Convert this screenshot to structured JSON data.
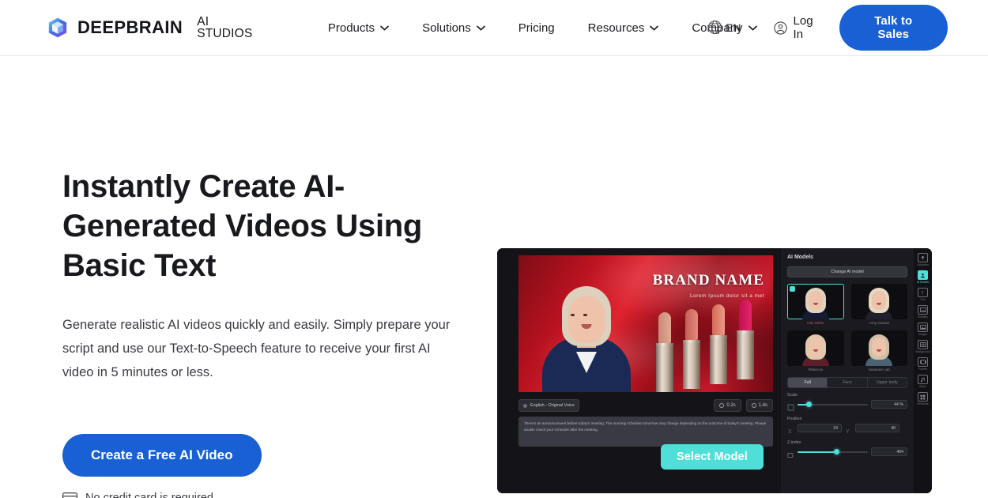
{
  "header": {
    "brand": {
      "name": "DEEPBRAIN",
      "sub": "AI STUDIOS",
      "logo_icon": "cube-logo-icon"
    },
    "nav": [
      {
        "label": "Products",
        "has_caret": true
      },
      {
        "label": "Solutions",
        "has_caret": true
      },
      {
        "label": "Pricing",
        "has_caret": false
      },
      {
        "label": "Resources",
        "has_caret": true
      },
      {
        "label": "Company",
        "has_caret": true
      }
    ],
    "language": {
      "label": "EN",
      "icon": "globe-icon"
    },
    "login": {
      "label": "Log In",
      "icon": "user-circle-icon"
    },
    "cta": {
      "label": "Talk to Sales"
    }
  },
  "hero": {
    "title": "Instantly Create AI-Generated Videos Using Basic Text",
    "description": "Generate realistic AI videos quickly and easily. Simply prepare your script and use our Text-to-Speech feature to receive your first AI video in 5 minutes or less.",
    "cta_label": "Create a Free AI Video",
    "no_card_note": "No credit card is required",
    "no_card_icon": "credit-card-icon"
  },
  "mockup": {
    "stage": {
      "brand_title": "BRAND NAME",
      "brand_subtitle": "Lorem Ipsum dolor sit a met"
    },
    "toolbar": {
      "voice_chip": "English - Original Voice",
      "time_chips": [
        "0.2s",
        "1.4s"
      ]
    },
    "script_placeholder": "There's an announcement before today's meeting. The morning schedule tomorrow may change depending on the outcome of today's meeting. Please double check your schedule after the meeting.",
    "select_model_tooltip": "Select Model",
    "sidebar": {
      "title": "AI Models",
      "change_button": "Change AI model",
      "models": [
        {
          "name": "Nila White",
          "selected": true
        },
        {
          "name": "Amy Casual",
          "selected": false
        },
        {
          "name": "Rebecca",
          "selected": false
        },
        {
          "name": "Susanne Lab",
          "selected": false
        }
      ],
      "tabs": [
        {
          "label": "Full",
          "active": true
        },
        {
          "label": "Face",
          "active": false
        },
        {
          "label": "Upper body",
          "active": false
        }
      ],
      "controls": [
        {
          "label": "Scale",
          "type": "slider",
          "value": "44 %",
          "percent": 12
        },
        {
          "label": "Position",
          "type": "pair",
          "x": "24",
          "y": "40"
        },
        {
          "label": "Z-index",
          "type": "slider",
          "value": "404",
          "percent": 52
        }
      ]
    },
    "rail": [
      {
        "label": "Uploaded",
        "icon": "upload-icon",
        "active": false
      },
      {
        "label": "AI Models",
        "icon": "person-icon",
        "active": true
      },
      {
        "label": "Text",
        "icon": "text-icon",
        "active": false
      },
      {
        "label": "Subtitles",
        "icon": "subtitle-icon",
        "active": false
      },
      {
        "label": "Images",
        "icon": "image-icon",
        "active": false
      },
      {
        "label": "Background",
        "icon": "background-icon",
        "active": false
      },
      {
        "label": "Frames",
        "icon": "frames-icon",
        "active": false
      },
      {
        "label": "Audio",
        "icon": "audio-icon",
        "active": false
      },
      {
        "label": "Elements",
        "icon": "elements-icon",
        "active": false
      }
    ]
  },
  "colors": {
    "brand_blue": "#1860d3",
    "accent_teal": "#4ee0d8",
    "text_dark": "#18191d"
  }
}
